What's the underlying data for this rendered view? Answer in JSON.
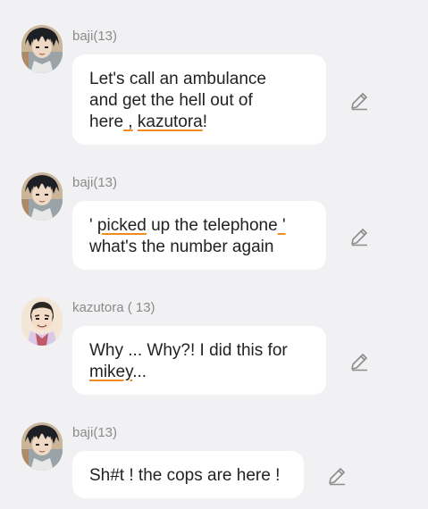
{
  "messages": [
    {
      "sender": "baji(13)",
      "avatar": "baji-avatar",
      "lines": [
        [
          "Let's call an ambulance"
        ],
        [
          "and get the hell out of"
        ],
        [
          "here",
          " ,",
          " ",
          "kazutora",
          "!"
        ]
      ]
    },
    {
      "sender": "baji(13)",
      "avatar": "baji-avatar",
      "lines": [
        [
          "' ",
          "picked",
          " up the telephone",
          " '"
        ],
        [
          "what's the number again"
        ]
      ]
    },
    {
      "sender": "kazutora ( 13)",
      "avatar": "kazutora-avatar",
      "lines": [
        [
          "Why ... Why?! I did this for"
        ],
        [
          "mikey",
          "..."
        ]
      ]
    },
    {
      "sender": "baji(13)",
      "avatar": "baji-avatar",
      "lines": [
        [
          "Sh#t ! the cops are here !"
        ]
      ]
    }
  ],
  "colors": {
    "background": "#f1f1f3",
    "bubble": "#ffffff",
    "text": "#222222",
    "name": "#8a8a8a",
    "spellcheck_underline": "#ef8b1f",
    "icon": "#8c8c8c"
  },
  "icons": {
    "edit": "pencil-edit-icon"
  }
}
